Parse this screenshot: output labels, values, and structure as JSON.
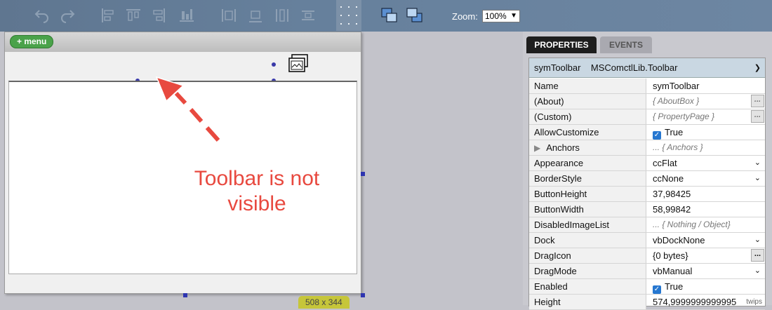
{
  "toolbar": {
    "zoom_label": "Zoom:",
    "zoom_value": "100%",
    "icons": [
      "undo-icon",
      "redo-icon",
      "align-left-icon",
      "align-top-icon",
      "align-right-icon",
      "align-bottom-icon",
      "center-horizontal-icon",
      "center-vertical-icon",
      "space-horizontal-icon",
      "space-vertical-icon",
      "grid-icon",
      "bring-to-front-icon",
      "send-to-back-icon"
    ]
  },
  "form": {
    "menu_label": "+ menu",
    "annotation_line1": "Toolbar is not",
    "annotation_line2": "visible",
    "size_badge": "508 x 344"
  },
  "panel": {
    "tabs": [
      "PROPERTIES",
      "EVENTS"
    ],
    "object_name": "symToolbar",
    "object_type": "MSComctlLib.Toolbar",
    "properties": [
      {
        "name": "Name",
        "value": "symToolbar",
        "kind": "text"
      },
      {
        "name": "(About)",
        "value": "{ AboutBox }",
        "kind": "ellipsis"
      },
      {
        "name": "(Custom)",
        "value": "{ PropertyPage }",
        "kind": "ellipsis"
      },
      {
        "name": "AllowCustomize",
        "value": "True",
        "kind": "check"
      },
      {
        "name": "Anchors",
        "value": "... { Anchors }",
        "kind": "group"
      },
      {
        "name": "Appearance",
        "value": "ccFlat",
        "kind": "select"
      },
      {
        "name": "BorderStyle",
        "value": "ccNone",
        "kind": "select"
      },
      {
        "name": "ButtonHeight",
        "value": "37,98425",
        "kind": "text"
      },
      {
        "name": "ButtonWidth",
        "value": "58,99842",
        "kind": "text"
      },
      {
        "name": "DisabledImageList",
        "value": "... { Nothing / Object}",
        "kind": "placeholder"
      },
      {
        "name": "Dock",
        "value": "vbDockNone",
        "kind": "select"
      },
      {
        "name": "DragIcon",
        "value": "{0 bytes}",
        "kind": "ellipsis-plain"
      },
      {
        "name": "DragMode",
        "value": "vbManual",
        "kind": "select"
      },
      {
        "name": "Enabled",
        "value": "True",
        "kind": "check"
      },
      {
        "name": "Height",
        "value": "574,9999999999995",
        "kind": "unit",
        "unit": "twips"
      }
    ]
  },
  "colors": {
    "toolbar_bg": "#66809c",
    "tab_active": "#1e1e1e",
    "annotation": "#e8493f",
    "handle": "#3a3aa8",
    "checkbox": "#2677d0",
    "menu_button": "#4aa24a"
  }
}
